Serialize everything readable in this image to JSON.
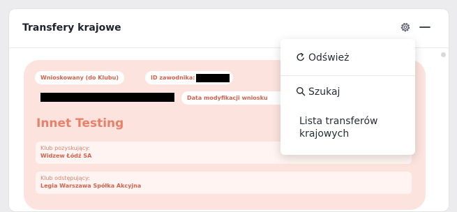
{
  "panel": {
    "title": "Transfery krajowe",
    "icons": {
      "settings": "gear-icon",
      "collapse": "minus-icon"
    }
  },
  "card": {
    "status_pill": "Wnioskowany (do Klubu)",
    "player_id_label": "ID zawodnika:",
    "date_label": "Data modyfikacji wniosku",
    "name": "Innet Testing",
    "acquiring_club": {
      "label": "Klub pozyskujący:",
      "value": "Widzew Łódź SA"
    },
    "releasing_club": {
      "label": "Klub odstępujący:",
      "value": "Legia Warszawa Spółka Akcyjna"
    }
  },
  "menu": {
    "refresh": "Odśwież",
    "search": "Szukaj",
    "list": "Lista transferów krajowych"
  },
  "colors": {
    "card_bg": "#fce3dd",
    "accent": "#e7816a",
    "accent_dark": "#d4624b"
  }
}
